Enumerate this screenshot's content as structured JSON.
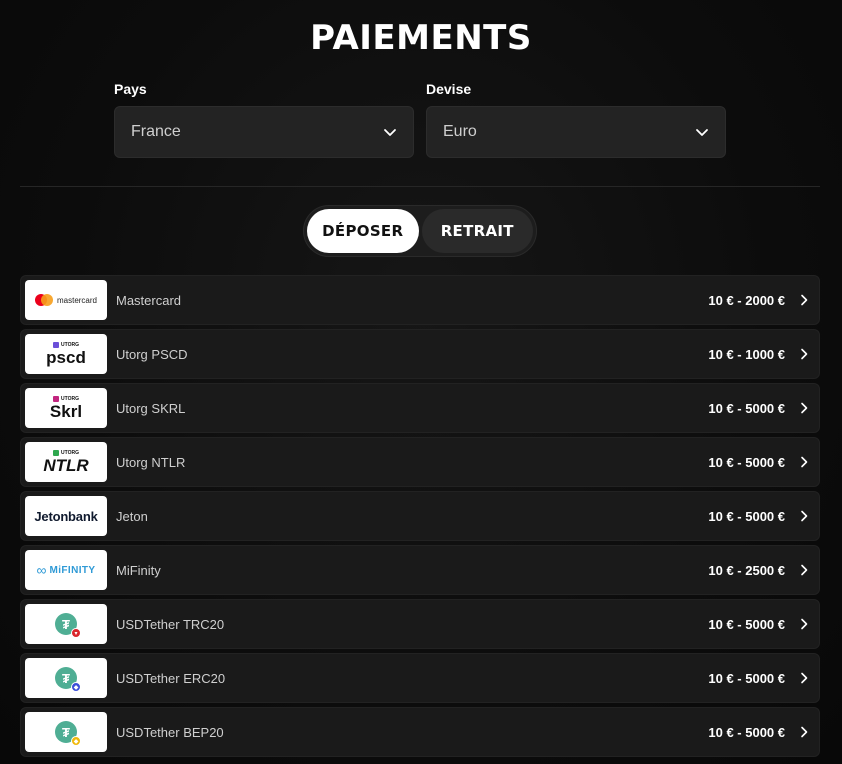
{
  "page": {
    "title": "PAIEMENTS"
  },
  "filters": {
    "country": {
      "label": "Pays",
      "value": "France"
    },
    "currency": {
      "label": "Devise",
      "value": "Euro"
    }
  },
  "tabs": {
    "deposit": "DÉPOSER",
    "withdraw": "RETRAIT",
    "active": "deposit"
  },
  "methods": [
    {
      "name": "Mastercard",
      "range": "10 € - 2000 €",
      "logo": "mastercard-logo",
      "logo_text": "mastercard"
    },
    {
      "name": "Utorg PSCD",
      "range": "10 € - 1000 €",
      "logo": "utorg-pscd-logo",
      "logo_top": "UTORG",
      "logo_main": "pscd",
      "mark_color": "#6b4fd8"
    },
    {
      "name": "Utorg SKRL",
      "range": "10 € - 5000 €",
      "logo": "utorg-skrl-logo",
      "logo_top": "UTORG",
      "logo_main": "Skrl",
      "mark_color": "#c2257f"
    },
    {
      "name": "Utorg NTLR",
      "range": "10 € - 5000 €",
      "logo": "utorg-ntlr-logo",
      "logo_top": "UTORG",
      "logo_main": "NTLR",
      "mark_color": "#2fa84f"
    },
    {
      "name": "Jeton",
      "range": "10 € - 5000 €",
      "logo": "jeton-logo",
      "logo_text": "Jetonbank"
    },
    {
      "name": "MiFinity",
      "range": "10 € - 2500 €",
      "logo": "mifinity-logo",
      "logo_text": "MiFINITY"
    },
    {
      "name": "USDTether TRC20",
      "range": "10 € - 5000 €",
      "logo": "tether-trc20-logo",
      "badge_color": "#d9262c"
    },
    {
      "name": "USDTether ERC20",
      "range": "10 € - 5000 €",
      "logo": "tether-erc20-logo",
      "badge_color": "#3b4ed8"
    },
    {
      "name": "USDTether BEP20",
      "range": "10 € - 5000 €",
      "logo": "tether-bep20-logo",
      "badge_color": "#f0b90b"
    }
  ]
}
